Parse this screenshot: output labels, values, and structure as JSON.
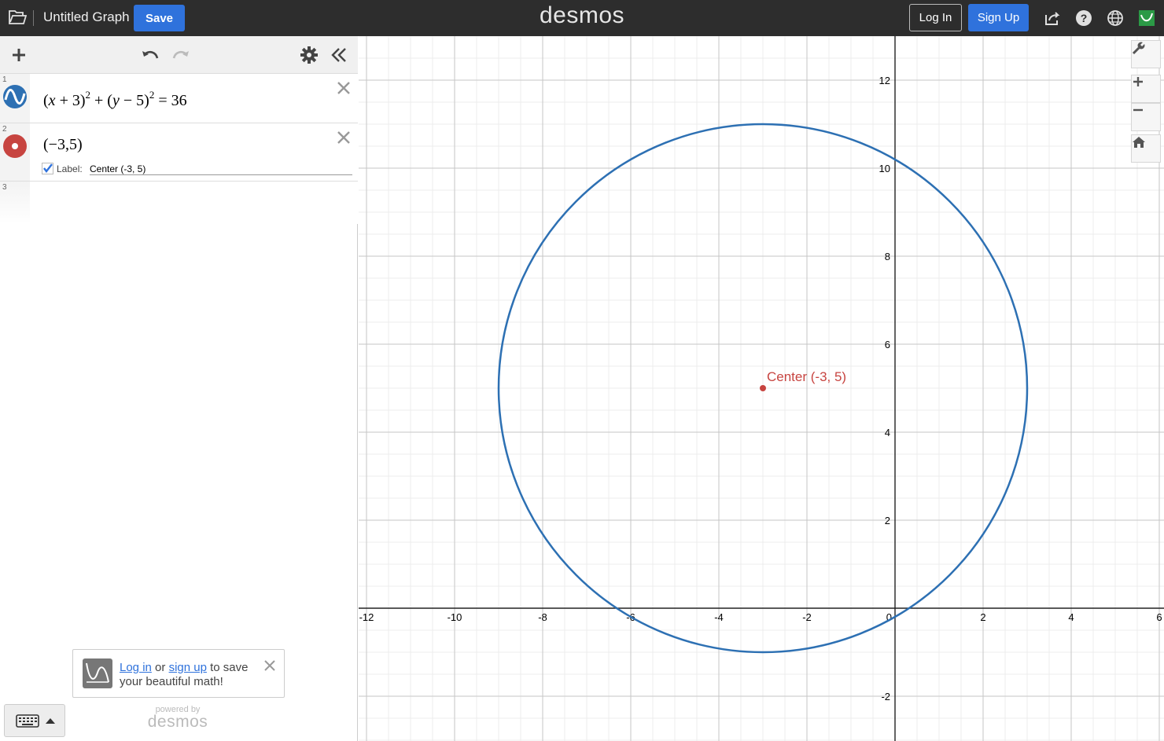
{
  "topbar": {
    "title": "Untitled Graph",
    "save_label": "Save",
    "logo": "desmos",
    "login_label": "Log In",
    "signup_label": "Sign Up",
    "icons": [
      "folder-icon",
      "share-icon",
      "help-icon",
      "globe-icon",
      "account-icon"
    ]
  },
  "panel": {
    "header_icons": [
      "add-icon",
      "undo-icon",
      "redo-icon",
      "settings-icon",
      "collapse-icon"
    ],
    "expressions": [
      {
        "index": "1",
        "latex_text": "(x + 3)^2 + (y − 5)^2 = 36",
        "color": "#2d70b3",
        "type": "equation"
      },
      {
        "index": "2",
        "latex_text": "(−3,5)",
        "color": "#c74440",
        "type": "point",
        "label_checkbox": "Label:",
        "label_value": "Center (-3, 5)",
        "label_checked": true
      },
      {
        "index": "3",
        "latex_text": "",
        "type": "empty"
      }
    ],
    "promo": {
      "login_link": "Log in",
      "or": "or",
      "signup_link": "sign up",
      "rest": "to save your beautiful math!"
    },
    "powered_by": "powered by",
    "powered_logo": "desmos"
  },
  "graph": {
    "x_ticks": [
      "-12",
      "-10",
      "-8",
      "-6",
      "-4",
      "-2",
      "0",
      "2",
      "4",
      "6"
    ],
    "y_ticks": [
      "12",
      "10",
      "8",
      "6",
      "4",
      "2",
      "-2"
    ],
    "circle": {
      "center_x": -3,
      "center_y": 5,
      "radius": 6,
      "color": "#2d70b3"
    },
    "point": {
      "x": -3,
      "y": 5,
      "label": "Center (-3, 5)",
      "color": "#c74440"
    },
    "controls": [
      "wrench-icon",
      "zoom-in-icon",
      "zoom-out-icon",
      "home-icon"
    ]
  }
}
